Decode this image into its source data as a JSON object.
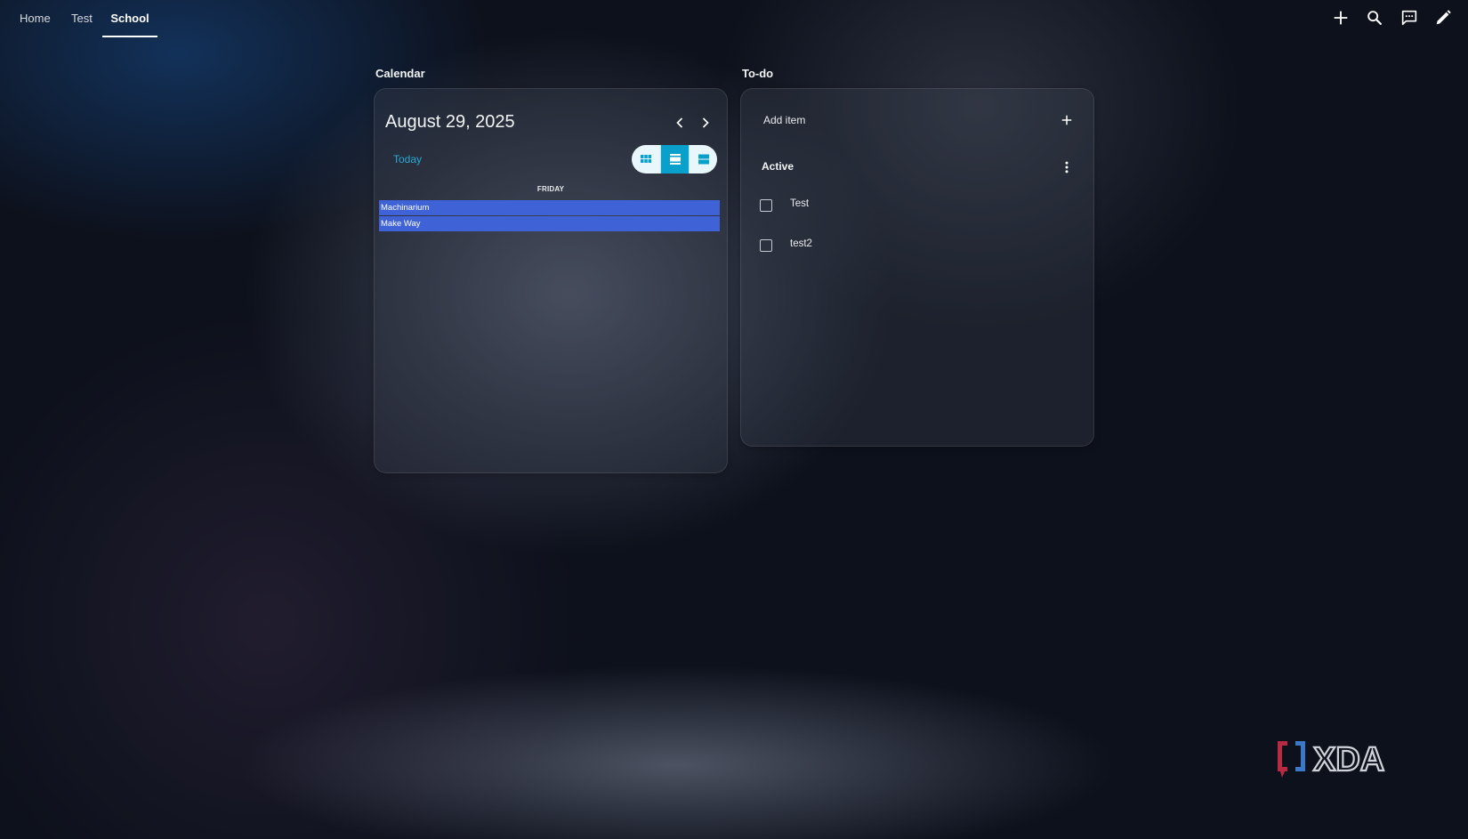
{
  "tabs": [
    {
      "label": "Home"
    },
    {
      "label": "Test"
    },
    {
      "label": "School",
      "active": true
    }
  ],
  "toolbar": {
    "icons": [
      "plus-icon",
      "search-icon",
      "chat-icon",
      "pencil-icon"
    ]
  },
  "calendar": {
    "section_title": "Calendar",
    "date": "August 29, 2025",
    "today_label": "Today",
    "view_options": [
      "grid-view-icon",
      "list-view-icon",
      "week-view-icon"
    ],
    "selected_view": "list-view-icon",
    "day_header": "FRIDAY",
    "events": [
      "Machinarium",
      "Make Way"
    ],
    "event_color": "#3f63d6"
  },
  "todo": {
    "section_title": "To-do",
    "add_placeholder": "Add item",
    "list_name": "Active",
    "items": [
      {
        "text": "Test",
        "checked": false
      },
      {
        "text": "test2",
        "checked": false
      }
    ]
  },
  "watermark": {
    "text": "XDA"
  },
  "colors": {
    "accent": "#0aa0cc",
    "today_link": "#29a9d6",
    "logo_red": "#b82a43",
    "logo_blue": "#3a78c8"
  }
}
